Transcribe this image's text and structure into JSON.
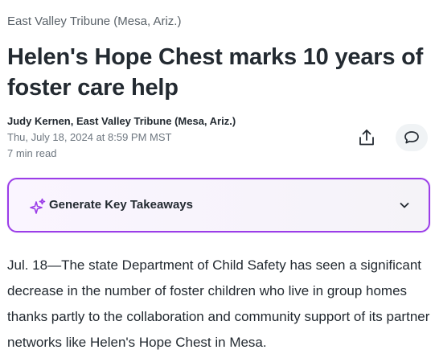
{
  "article": {
    "source": "East Valley Tribune (Mesa, Ariz.)",
    "headline": "Helen's Hope Chest marks 10 years of foster care help",
    "byline": "Judy Kernen, East Valley Tribune (Mesa, Ariz.)",
    "date": "Thu, July 18, 2024 at 8:59 PM MST",
    "read_time": "7 min read",
    "body_paragraph": "Jul. 18—The state Department of Child Safety has seen a significant decrease in the number of foster children who live in group homes thanks partly to the collaboration and community support of its partner networks like Helen's Hope Chest in Mesa."
  },
  "actions": {
    "share_icon": "share-icon",
    "comment_icon": "comment-icon"
  },
  "takeaways": {
    "label": "Generate Key Takeaways",
    "icon": "sparkle-icon",
    "expand_icon": "chevron-down-icon",
    "accent_color": "#9b3de8"
  }
}
